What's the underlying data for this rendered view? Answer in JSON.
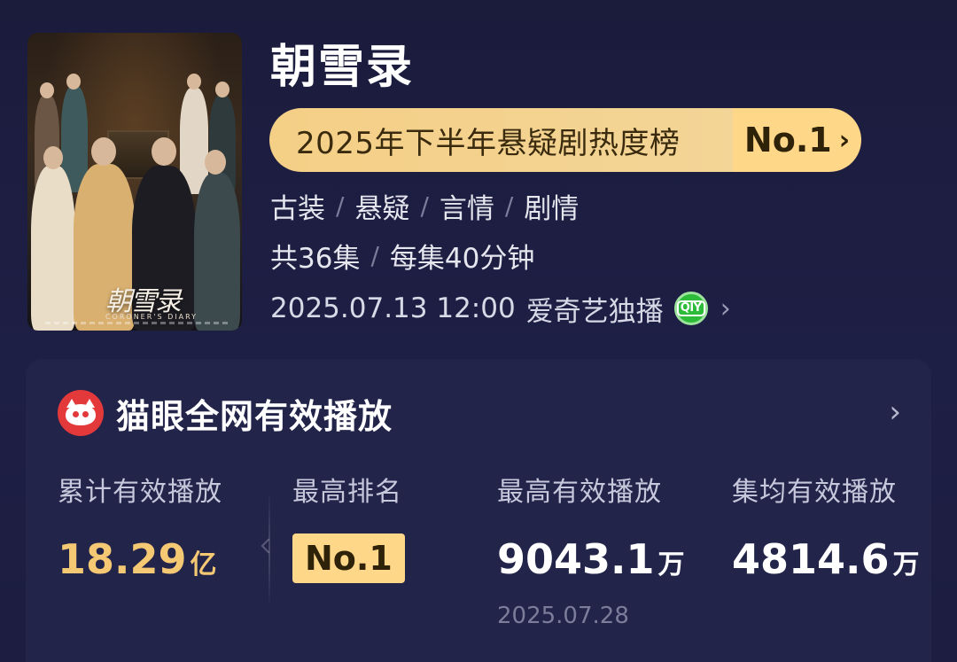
{
  "drama": {
    "title": "朝雪录",
    "poster_calligraphy": "朝雪录",
    "poster_english": "CORONER'S DIARY"
  },
  "ranking_banner": {
    "label": "2025年下半年悬疑剧热度榜",
    "rank": "No.1",
    "chevron": "›"
  },
  "tags": [
    "古装",
    "悬疑",
    "言情",
    "剧情"
  ],
  "tag_separator": "/",
  "episodes": {
    "count": "共36集",
    "duration": "每集40分钟"
  },
  "release": {
    "datetime": "2025.07.13 12:00",
    "platform": "爱奇艺独播",
    "platform_icon": "iqiyi-icon",
    "platform_icon_text": "QIY",
    "chevron": "›"
  },
  "maoyan_card": {
    "title": "猫眼全网有效播放",
    "icon": "maoyan-cat-icon",
    "chevron": "›",
    "stats": [
      {
        "label": "累计有效播放",
        "value": "18.29",
        "unit": "亿"
      },
      {
        "label": "最高排名",
        "value": "No.1"
      },
      {
        "label": "最高有效播放",
        "value": "9043.1",
        "unit": "万",
        "date": "2025.07.28"
      },
      {
        "label": "集均有效播放",
        "value": "4814.6",
        "unit": "万"
      }
    ]
  },
  "colors": {
    "background": "#1c1d3d",
    "card": "#22244a",
    "accent_gold": "#f5c873",
    "banner_gold": "#f4cf86",
    "badge_gold": "#ffd789",
    "iqiyi_green": "#2dbc3a",
    "maoyan_red": "#e3393a"
  }
}
